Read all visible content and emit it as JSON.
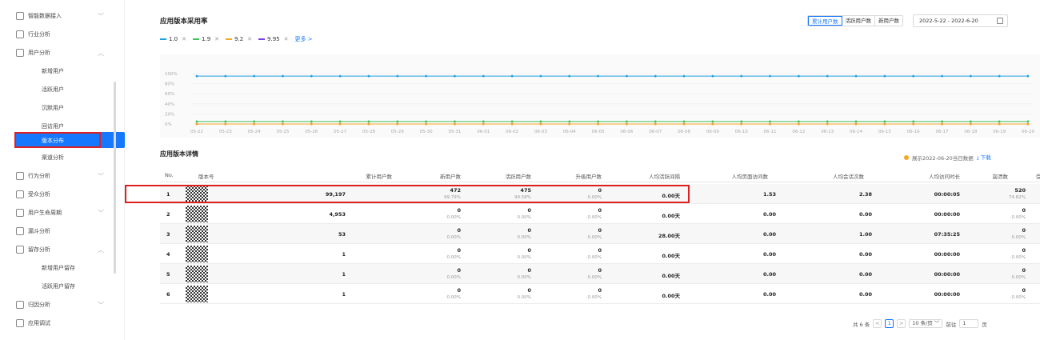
{
  "sidebar": {
    "items": [
      {
        "label": "智能数据接入",
        "icon": "plug-icon",
        "chevron": "﹀",
        "y": 10
      },
      {
        "label": "行业分析",
        "icon": "monitor-icon",
        "chevron": "",
        "y": 33
      },
      {
        "label": "用户分析",
        "icon": "user-icon",
        "chevron": "︿",
        "y": 56
      }
    ],
    "subitems_user": [
      {
        "label": "新增用户",
        "y": 79
      },
      {
        "label": "活跃用户",
        "y": 102
      },
      {
        "label": "沉默用户",
        "y": 125
      },
      {
        "label": "回访用户",
        "y": 148
      }
    ],
    "active": "版本分布",
    "after_active": [
      {
        "label": "渠道分析",
        "y": 187
      }
    ],
    "items2": [
      {
        "label": "行为分析",
        "icon": "chart-icon",
        "chevron": "﹀",
        "y": 210
      },
      {
        "label": "受众分析",
        "icon": "people-icon",
        "chevron": "",
        "y": 233
      },
      {
        "label": "用户生命周期",
        "icon": "cycle-icon",
        "chevron": "﹀",
        "y": 256
      },
      {
        "label": "漏斗分析",
        "icon": "funnel-icon",
        "chevron": "",
        "y": 279
      },
      {
        "label": "留存分析",
        "icon": "retain-icon",
        "chevron": "︿",
        "y": 302
      }
    ],
    "subitems_retain": [
      {
        "label": "新增用户留存",
        "y": 325
      },
      {
        "label": "活跃用户留存",
        "y": 348
      }
    ],
    "items3": [
      {
        "label": "归因分析",
        "icon": "attribution-icon",
        "chevron": "﹀",
        "y": 371
      },
      {
        "label": "应用调试",
        "icon": "debug-icon",
        "chevron": "",
        "y": 394
      }
    ]
  },
  "header": {
    "title": "应用版本采用率",
    "segments": [
      "累计用户数",
      "活跃用户数",
      "新用户数"
    ],
    "selected_segment": "累计用户数",
    "date_range": "2022-5-22 - 2022-6-20"
  },
  "legend": [
    {
      "label": "1.0",
      "color": "#1aa0e0"
    },
    {
      "label": "1.9",
      "color": "#3ec35b"
    },
    {
      "label": "9.2",
      "color": "#f5a623"
    },
    {
      "label": "9.95",
      "color": "#7b3fe4"
    }
  ],
  "legend_close": "✕",
  "legend_more": "更多 >",
  "chart_data": {
    "type": "line",
    "x": [
      "05-22",
      "05-23",
      "05-24",
      "05-25",
      "05-26",
      "05-27",
      "05-28",
      "05-29",
      "05-30",
      "05-31",
      "06-01",
      "06-02",
      "06-03",
      "06-04",
      "06-05",
      "06-06",
      "06-07",
      "06-08",
      "06-09",
      "06-10",
      "06-11",
      "06-12",
      "06-13",
      "06-14",
      "06-15",
      "06-16",
      "06-17",
      "06-18",
      "06-19",
      "06-20"
    ],
    "y_ticks": [
      "100%",
      "80%",
      "60%",
      "40%",
      "20%",
      "0%"
    ],
    "ylim": [
      0,
      100
    ],
    "series": [
      {
        "name": "1.0",
        "color": "#1aa0e0",
        "values": [
          95,
          95,
          95,
          95,
          95,
          95,
          95,
          95,
          95,
          95,
          95,
          95,
          95,
          95,
          95,
          95,
          95,
          95,
          95,
          95,
          95,
          95,
          95,
          95,
          95,
          95,
          95,
          95,
          95,
          95
        ]
      },
      {
        "name": "1.9",
        "color": "#3ec35b",
        "values": [
          5,
          5,
          5,
          5,
          5,
          5,
          5,
          5,
          5,
          5,
          5,
          5,
          5,
          5,
          5,
          5,
          5,
          5,
          5,
          5,
          5,
          5,
          5,
          5,
          5,
          5,
          5,
          5,
          5,
          5
        ]
      },
      {
        "name": "9.2",
        "color": "#f5a623",
        "values": [
          0,
          0,
          0,
          0,
          0,
          0,
          0,
          0,
          0,
          0,
          0,
          0,
          0,
          0,
          0,
          0,
          0,
          0,
          0,
          0,
          0,
          0,
          0,
          0,
          0,
          0,
          0,
          0,
          0,
          0
        ]
      },
      {
        "name": "9.95",
        "color": "#7b3fe4",
        "values": [
          0,
          0,
          0,
          0,
          0,
          0,
          0,
          0,
          0,
          0,
          0,
          0,
          0,
          0,
          0,
          0,
          0,
          0,
          0,
          0,
          0,
          0,
          0,
          0,
          0,
          0,
          0,
          0,
          0,
          0
        ]
      }
    ]
  },
  "detail": {
    "title": "应用版本详情",
    "show_data": "展示2022-06-20当日数据",
    "download": "下载",
    "columns": [
      "No.",
      "版本号",
      "累计用户数",
      "新用户数",
      "活跃用户数",
      "升级用户数",
      "人均活跃间隔",
      "人均页面访问数",
      "人均会话次数",
      "人均访问时长",
      "崩溃数",
      "受影"
    ],
    "rows": [
      {
        "no": "1",
        "total": "99,197",
        "new": "472",
        "new_pct": "99.79%",
        "active": "475",
        "active_pct": "99.58%",
        "upg": "0",
        "upg_pct": "0.00%",
        "interval": "0.00天",
        "pv": "1.53",
        "sess": "2.38",
        "dur": "00:00:05",
        "crash": "520",
        "crash_pct": "74.82%"
      },
      {
        "no": "2",
        "total": "4,953",
        "new": "0",
        "new_pct": "0.00%",
        "active": "0",
        "active_pct": "0.00%",
        "upg": "0",
        "upg_pct": "0.00%",
        "interval": "0.00天",
        "pv": "0.00",
        "sess": "0.00",
        "dur": "00:00:00",
        "crash": "0",
        "crash_pct": "0.00%"
      },
      {
        "no": "3",
        "total": "53",
        "new": "0",
        "new_pct": "0.00%",
        "active": "0",
        "active_pct": "0.00%",
        "upg": "0",
        "upg_pct": "0.00%",
        "interval": "28.00天",
        "pv": "0.00",
        "sess": "1.00",
        "dur": "07:35:25",
        "crash": "0",
        "crash_pct": "0.00%"
      },
      {
        "no": "4",
        "total": "1",
        "new": "0",
        "new_pct": "0.00%",
        "active": "0",
        "active_pct": "0.00%",
        "upg": "0",
        "upg_pct": "0.00%",
        "interval": "0.00天",
        "pv": "0.00",
        "sess": "0.00",
        "dur": "00:00:00",
        "crash": "0",
        "crash_pct": "0.00%"
      },
      {
        "no": "5",
        "total": "1",
        "new": "0",
        "new_pct": "0.00%",
        "active": "0",
        "active_pct": "0.00%",
        "upg": "0",
        "upg_pct": "0.00%",
        "interval": "0.00天",
        "pv": "0.00",
        "sess": "0.00",
        "dur": "00:00:00",
        "crash": "0",
        "crash_pct": "0.00%"
      },
      {
        "no": "6",
        "total": "1",
        "new": "0",
        "new_pct": "0.00%",
        "active": "0",
        "active_pct": "0.00%",
        "upg": "0",
        "upg_pct": "0.00%",
        "interval": "0.00天",
        "pv": "0.00",
        "sess": "0.00",
        "dur": "00:00:00",
        "crash": "0",
        "crash_pct": "0.00%"
      }
    ]
  },
  "pager": {
    "total": "共 6 条",
    "prev": "<",
    "current": "1",
    "next": ">",
    "size": "10 条/页",
    "goto": "前往",
    "page_value": "1",
    "page_suffix": "页"
  }
}
